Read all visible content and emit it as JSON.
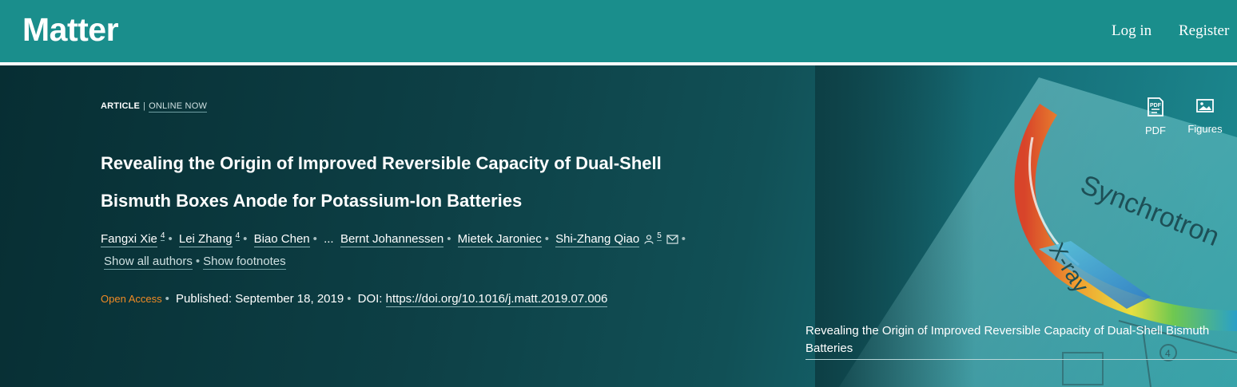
{
  "header": {
    "brand": "Matter",
    "login_label": "Log in",
    "register_label": "Register"
  },
  "article": {
    "type": "ARTICLE",
    "separator": "|",
    "status": "ONLINE NOW",
    "title": "Revealing the Origin of Improved Reversible Capacity of Dual-Shell Bismuth Boxes Anode for Potassium-Ion Batteries",
    "authors": [
      {
        "name": "Fangxi Xie",
        "sup": "4"
      },
      {
        "name": "Lei Zhang",
        "sup": "4"
      },
      {
        "name": "Biao Chen"
      },
      {
        "name": "Bernt Johannessen"
      },
      {
        "name": "Mietek Jaroniec"
      },
      {
        "name": "Shi-Zhang Qiao",
        "sup": "5"
      }
    ],
    "ellipsis": "...",
    "show_all_authors": "Show all authors",
    "show_footnotes": "Show footnotes",
    "open_access": "Open Access",
    "published": "Published: September 18, 2019",
    "doi_label": "DOI:",
    "doi": "https://doi.org/10.1016/j.matt.2019.07.006"
  },
  "tools": {
    "pdf_label": "PDF",
    "pdf_icon_text": "PDF",
    "figures_label": "Figures"
  },
  "cover": {
    "caption": "Revealing the Origin of Improved Reversible Capacity of Dual-Shell Bismuth Batteries",
    "synchrotron_text": "Synchrotron",
    "xray_text": "X-ray",
    "marker_text": "4"
  },
  "colors": {
    "header_bg": "#1a8e8c",
    "open_access": "#f08a24"
  }
}
